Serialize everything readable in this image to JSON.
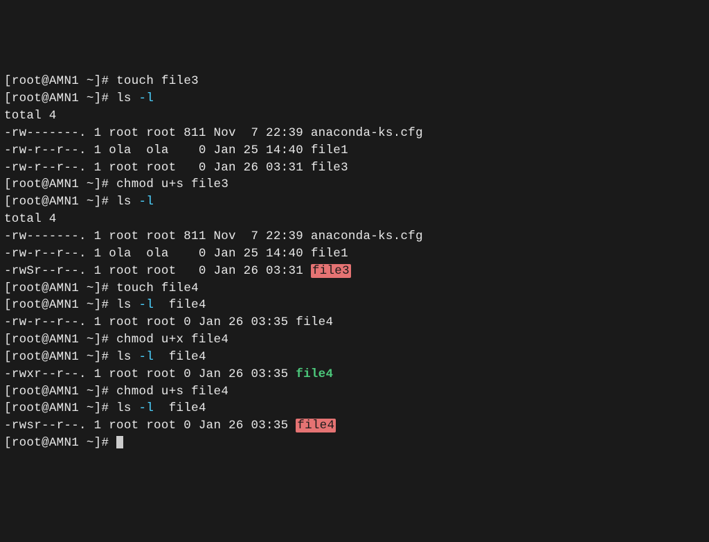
{
  "prompt": {
    "open": "[",
    "user": "root",
    "sep": "@",
    "host": "AMN1",
    "path": " ~",
    "close": "]",
    "hash": "#"
  },
  "lines": [
    {
      "type": "cmd",
      "cmd": "touch file3"
    },
    {
      "type": "cmd",
      "cmd": "ls",
      "opt": "-l"
    },
    {
      "type": "out",
      "text": "total 4"
    },
    {
      "type": "out",
      "text": "-rw-------. 1 root root 811 Nov  7 22:39 anaconda-ks.cfg"
    },
    {
      "type": "out",
      "text": "-rw-r--r--. 1 ola  ola    0 Jan 25 14:40 file1"
    },
    {
      "type": "out",
      "text": "-rw-r--r--. 1 root root   0 Jan 26 03:31 file3"
    },
    {
      "type": "cmd",
      "cmd": "chmod u+s file3"
    },
    {
      "type": "cmd",
      "cmd": "ls",
      "opt": "-l"
    },
    {
      "type": "out",
      "text": "total 4"
    },
    {
      "type": "out",
      "text": "-rw-------. 1 root root 811 Nov  7 22:39 anaconda-ks.cfg"
    },
    {
      "type": "out",
      "text": "-rw-r--r--. 1 ola  ola    0 Jan 25 14:40 file1"
    },
    {
      "type": "out-hl",
      "pre": "-rwSr--r--. 1 root root   0 Jan 26 03:31 ",
      "hl": "file3"
    },
    {
      "type": "cmd",
      "cmd": "touch file4"
    },
    {
      "type": "cmd",
      "cmd": "ls",
      "opt": "-l",
      "trail": "  file4"
    },
    {
      "type": "out",
      "text": "-rw-r--r--. 1 root root 0 Jan 26 03:35 file4"
    },
    {
      "type": "cmd",
      "cmd": "chmod u+x file4"
    },
    {
      "type": "cmd",
      "cmd": "ls",
      "opt": "-l",
      "trail": "  file4"
    },
    {
      "type": "out-exec",
      "pre": "-rwxr--r--. 1 root root 0 Jan 26 03:35 ",
      "exec": "file4"
    },
    {
      "type": "cmd",
      "cmd": "chmod u+s file4"
    },
    {
      "type": "cmd",
      "cmd": "ls",
      "opt": "-l",
      "trail": "  file4"
    },
    {
      "type": "out-hl",
      "pre": "-rwsr--r--. 1 root root 0 Jan 26 03:35 ",
      "hl": "file4"
    },
    {
      "type": "cmd",
      "cmd": "",
      "cursor": true
    }
  ]
}
